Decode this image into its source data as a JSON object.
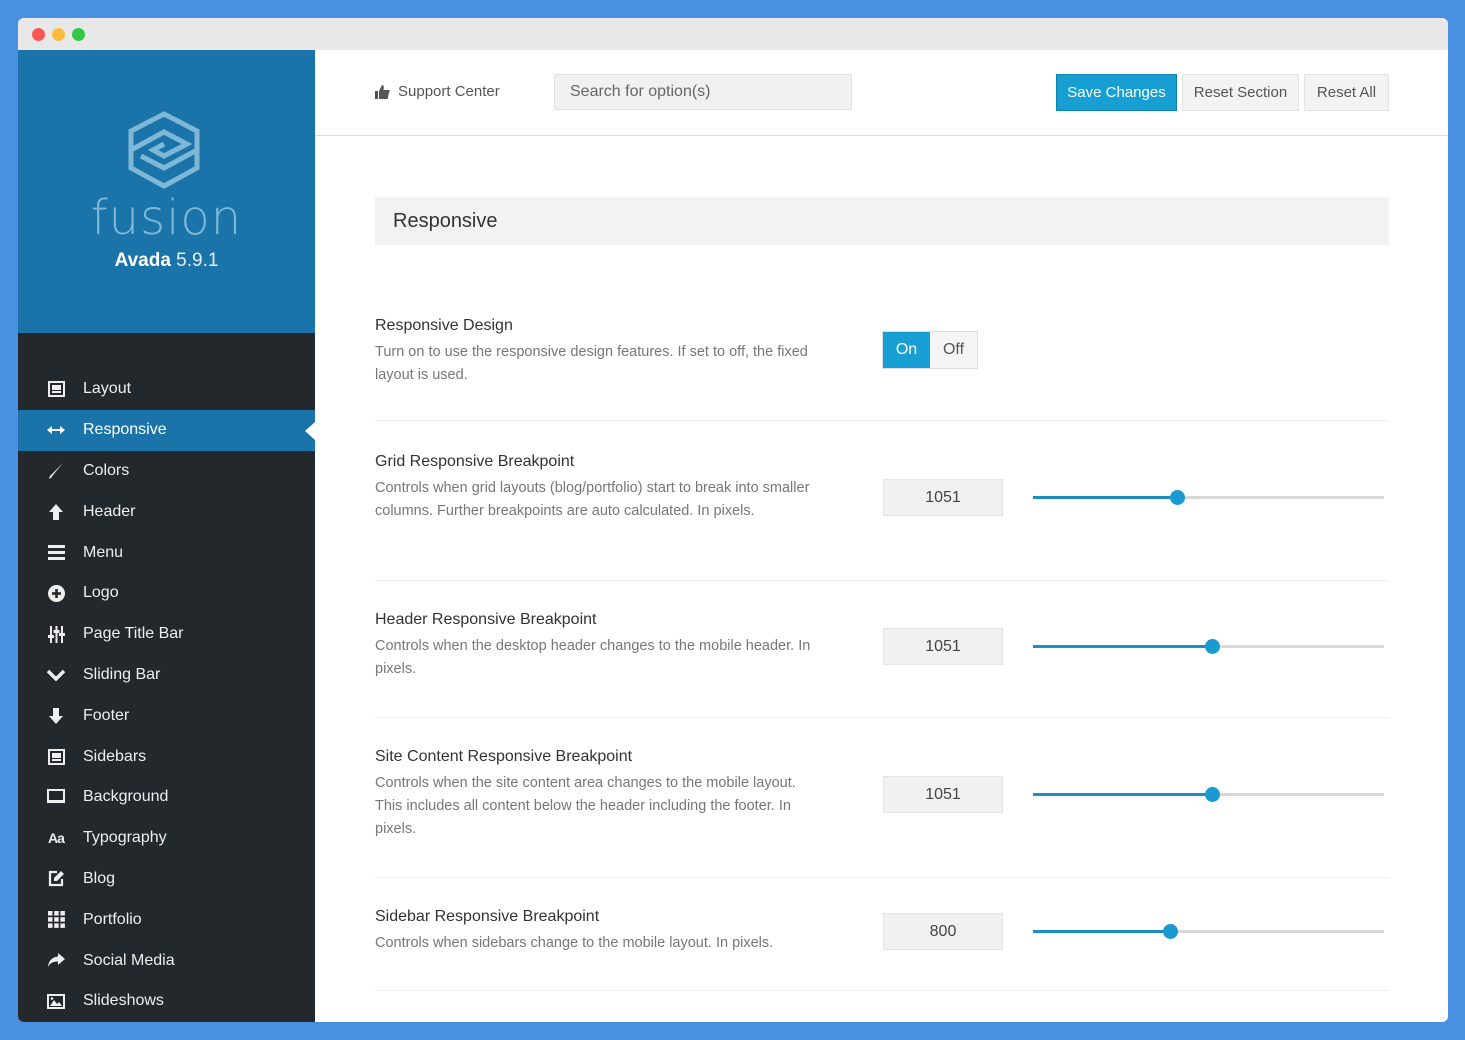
{
  "window": {
    "controls": [
      "close",
      "minimize",
      "maximize"
    ]
  },
  "brand": {
    "logo_icon": "fusion-hexagon-logo",
    "wordmark": "fusion",
    "product": "Avada",
    "version": "5.9.1"
  },
  "sidebar": {
    "items": [
      {
        "label": "Layout",
        "icon": "layout-icon",
        "active": false
      },
      {
        "label": "Responsive",
        "icon": "arrows-horizontal-icon",
        "active": true
      },
      {
        "label": "Colors",
        "icon": "brush-icon",
        "active": false
      },
      {
        "label": "Header",
        "icon": "arrow-up-icon",
        "active": false
      },
      {
        "label": "Menu",
        "icon": "hamburger-menu-icon",
        "active": false
      },
      {
        "label": "Logo",
        "icon": "plus-circle-icon",
        "active": false
      },
      {
        "label": "Page Title Bar",
        "icon": "sliders-icon",
        "active": false
      },
      {
        "label": "Sliding Bar",
        "icon": "chevron-down-icon",
        "active": false
      },
      {
        "label": "Footer",
        "icon": "arrow-down-icon",
        "active": false
      },
      {
        "label": "Sidebars",
        "icon": "sidebars-icon",
        "active": false
      },
      {
        "label": "Background",
        "icon": "monitor-icon",
        "active": false
      },
      {
        "label": "Typography",
        "icon": "typography-icon",
        "active": false
      },
      {
        "label": "Blog",
        "icon": "edit-icon",
        "active": false
      },
      {
        "label": "Portfolio",
        "icon": "grid-icon",
        "active": false
      },
      {
        "label": "Social Media",
        "icon": "share-icon",
        "active": false
      },
      {
        "label": "Slideshows",
        "icon": "image-icon",
        "active": false
      }
    ]
  },
  "topbar": {
    "support_label": "Support Center",
    "search_placeholder": "Search for option(s)",
    "search_value": "",
    "save_label": "Save Changes",
    "reset_section_label": "Reset Section",
    "reset_all_label": "Reset All"
  },
  "section": {
    "title": "Responsive",
    "responsive_design": {
      "title": "Responsive Design",
      "description": "Turn on to use the responsive design features. If set to off, the fixed layout is used.",
      "on_label": "On",
      "off_label": "Off",
      "value": "On"
    },
    "fields": [
      {
        "title": "Grid Responsive Breakpoint",
        "description": "Controls when grid layouts (blog/portfolio) start to break into smaller columns. Further breakpoints are auto calculated. In pixels.",
        "value": "1051",
        "slider_fraction": 0.41
      },
      {
        "title": "Header Responsive Breakpoint",
        "description": "Controls when the desktop header changes to the mobile header. In pixels.",
        "value": "1051",
        "slider_fraction": 0.51
      },
      {
        "title": "Site Content Responsive Breakpoint",
        "description": "Controls when the site content area changes to the mobile layout. This includes all content below the header including the footer. In pixels.",
        "value": "1051",
        "slider_fraction": 0.51
      },
      {
        "title": "Sidebar Responsive Breakpoint",
        "description": "Controls when sidebars change to the mobile layout. In pixels.",
        "value": "800",
        "slider_fraction": 0.39
      }
    ]
  },
  "colors": {
    "accent": "#179fd4",
    "sidebar_brand": "#1a74a9",
    "sidebar_bg": "#23282d",
    "page_bg": "#4a90e2"
  }
}
